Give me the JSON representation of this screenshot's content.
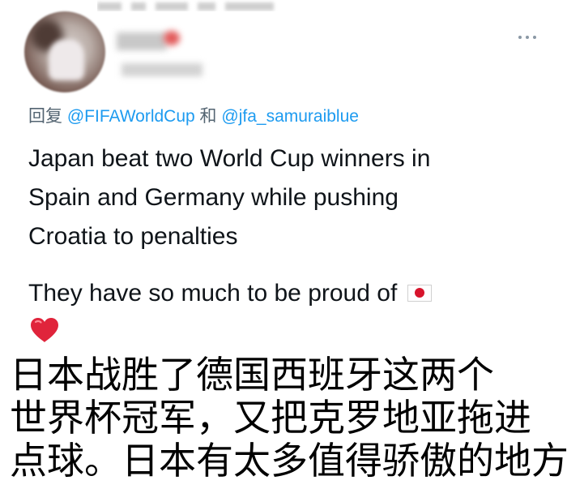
{
  "tweet": {
    "reply_prefix": "回复",
    "reply_mentions": [
      "@FIFAWorldCup",
      "@jfa_samuraiblue"
    ],
    "reply_joiner": "和",
    "body_lines": [
      "Japan beat two World Cup winners in",
      "Spain and Germany while pushing",
      "Croatia to penalties"
    ],
    "second_paragraph": "They have so much to be proud of",
    "emoji_icons": [
      "japan-flag-icon",
      "red-heart-icon"
    ]
  },
  "caption": {
    "lines": [
      "日本战胜了德国西班牙这两个",
      "世界杯冠军，又把克罗地亚拖进",
      "点球。日本有太多值得骄傲的地方"
    ]
  },
  "colors": {
    "mention_blue": "#1d9bf0",
    "secondary_gray": "#536471",
    "heart_red": "#e0243b",
    "flag_red": "#d7142c"
  }
}
